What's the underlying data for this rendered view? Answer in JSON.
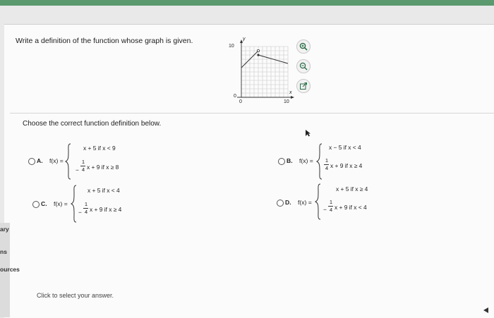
{
  "question": {
    "prompt": "Write a definition of the function whose graph is given.",
    "instruction": "Choose the correct function definition below."
  },
  "graph": {
    "y_axis_label": "y",
    "x_axis_label": "x",
    "y_tick": "10",
    "y_origin": "0",
    "x_origin": "0",
    "x_tick": "10"
  },
  "tools": {
    "zoom_in_icon": "zoom-in",
    "zoom_out_icon": "zoom-out",
    "popout_icon": "external-link"
  },
  "options": [
    {
      "letter": "A.",
      "lhs": "f(x) =",
      "case1": "x + 5 if x < 9",
      "case2_prefix": "−",
      "case2_num": "1",
      "case2_den": "4",
      "case2_rest": "x + 9 if x ≥ 8"
    },
    {
      "letter": "B.",
      "lhs": "f(x) =",
      "case1": "x − 5 if x < 4",
      "case2_prefix": "",
      "case2_num": "1",
      "case2_den": "4",
      "case2_rest": "x + 9 if x ≥ 4"
    },
    {
      "letter": "C.",
      "lhs": "f(x) =",
      "case1": "x + 5 if x < 4",
      "case2_prefix": "−",
      "case2_num": "1",
      "case2_den": "4",
      "case2_rest": "x + 9 if x ≥ 4"
    },
    {
      "letter": "D.",
      "lhs": "f(x) =",
      "case1": "x + 5 if x ≥ 4",
      "case2_prefix": "−",
      "case2_num": "1",
      "case2_den": "4",
      "case2_rest": "x + 9 if x < 4"
    }
  ],
  "sidebar": {
    "items": [
      "ary",
      "ns",
      "ources"
    ]
  },
  "status": {
    "text": "Click to select your answer."
  },
  "colors": {
    "topbar": "#5b9a6e",
    "zoom_icon": "#2b6a45"
  }
}
